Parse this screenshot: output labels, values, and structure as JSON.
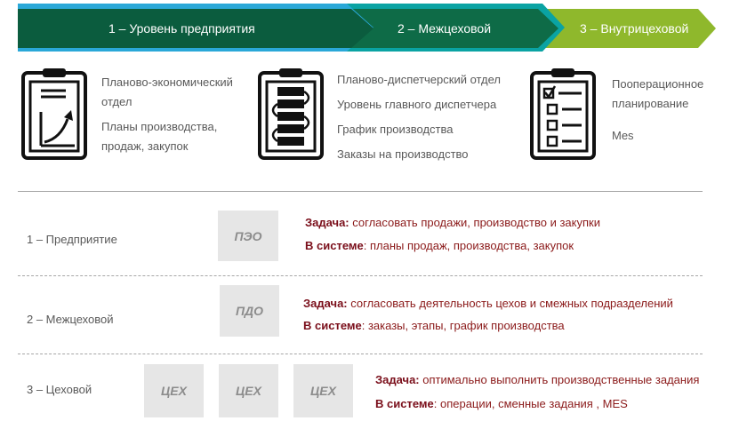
{
  "arrows": [
    {
      "label": "1 – Уровень предприятия",
      "color": "#0b5c3e"
    },
    {
      "label": "2 – Межцеховой",
      "color": "#0e6b47"
    },
    {
      "label": "3 – Внутрицеховой",
      "color": "#8fb82c"
    }
  ],
  "levels": [
    {
      "lines": [
        "Планово-экономический",
        "отдел",
        "Планы производства,",
        "продаж, закупок"
      ]
    },
    {
      "lines": [
        "Планово-диспетчерский отдел",
        "Уровень главного диспетчера",
        "График производства",
        "Заказы на производство"
      ]
    },
    {
      "lines": [
        "Пооперационное",
        "планирование",
        "Mes"
      ]
    }
  ],
  "rows": [
    {
      "label": "1 – Предприятие",
      "boxes": [
        "ПЭО"
      ],
      "task_label": "Задача:",
      "task_text": " согласовать продажи, производство и закупки",
      "system_label": "В системе",
      "system_text": ": планы продаж, производства, закупок"
    },
    {
      "label": "2 – Межцеховой",
      "boxes": [
        "ПДО"
      ],
      "task_label": "Задача:",
      "task_text": " согласовать деятельность цехов и смежных подразделений",
      "system_label": "В системе",
      "system_text": ":  заказы, этапы, график производства"
    },
    {
      "label": "3 – Цеховой",
      "boxes": [
        "ЦЕХ",
        "ЦЕХ",
        "ЦЕХ"
      ],
      "task_label": "Задача:",
      "task_text": " оптимально выполнить производственные задания",
      "system_label": "В системе",
      "system_text": ": операции,   сменные задания , MES"
    }
  ]
}
